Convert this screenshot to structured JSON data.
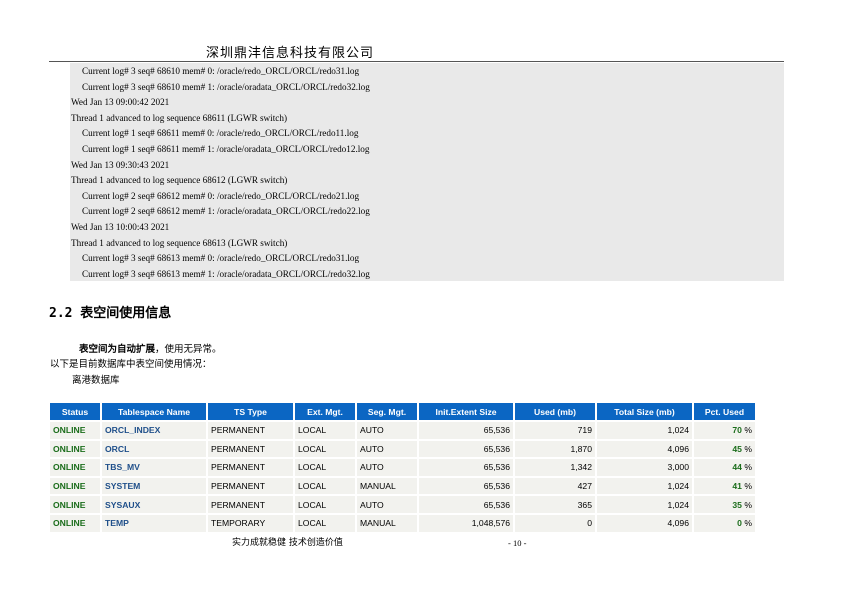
{
  "header": {
    "company": "深圳鼎沣信息科技有限公司"
  },
  "log_lines": [
    {
      "text": "Current log# 3 seq# 68610 mem# 0: /oracle/redo_ORCL/ORCL/redo31.log",
      "indent": true
    },
    {
      "text": "Current log# 3 seq# 68610 mem# 1: /oracle/oradata_ORCL/ORCL/redo32.log",
      "indent": true
    },
    {
      "text": "Wed Jan 13 09:00:42 2021",
      "indent": false
    },
    {
      "text": "Thread 1 advanced to log sequence 68611 (LGWR switch)",
      "indent": false
    },
    {
      "text": "Current log# 1 seq# 68611 mem# 0: /oracle/redo_ORCL/ORCL/redo11.log",
      "indent": true
    },
    {
      "text": "Current log# 1 seq# 68611 mem# 1: /oracle/oradata_ORCL/ORCL/redo12.log",
      "indent": true
    },
    {
      "text": "Wed Jan 13 09:30:43 2021",
      "indent": false
    },
    {
      "text": "Thread 1 advanced to log sequence 68612 (LGWR switch)",
      "indent": false
    },
    {
      "text": "Current log# 2 seq# 68612 mem# 0: /oracle/redo_ORCL/ORCL/redo21.log",
      "indent": true
    },
    {
      "text": "Current log# 2 seq# 68612 mem# 1: /oracle/oradata_ORCL/ORCL/redo22.log",
      "indent": true
    },
    {
      "text": "Wed Jan 13 10:00:43 2021",
      "indent": false
    },
    {
      "text": "Thread 1 advanced to log sequence 68613 (LGWR switch)",
      "indent": false
    },
    {
      "text": "Current log# 3 seq# 68613 mem# 0: /oracle/redo_ORCL/ORCL/redo31.log",
      "indent": true
    },
    {
      "text": "Current log# 3 seq# 68613 mem# 1: /oracle/oradata_ORCL/ORCL/redo32.log",
      "indent": true
    }
  ],
  "section": {
    "title": "2.2 表空间使用信息",
    "note_bold": "表空间为自动扩展",
    "note_rest": "，使用无异常。",
    "intro": "以下是目前数据库中表空间使用情况：",
    "db_name": "离港数据库"
  },
  "table": {
    "headers": [
      "Status",
      "Tablespace Name",
      "TS Type",
      "Ext. Mgt.",
      "Seg. Mgt.",
      "Init.Extent Size",
      "Used (mb)",
      "Total Size (mb)",
      "Pct. Used"
    ],
    "rows": [
      {
        "status": "ONLINE",
        "name": "ORCL_INDEX",
        "type": "PERMANENT",
        "ext": "LOCAL",
        "seg": "AUTO",
        "init": "65,536",
        "used": "719",
        "total": "1,024",
        "pct": "70",
        "pct_unit": "%"
      },
      {
        "status": "ONLINE",
        "name": "ORCL",
        "type": "PERMANENT",
        "ext": "LOCAL",
        "seg": "AUTO",
        "init": "65,536",
        "used": "1,870",
        "total": "4,096",
        "pct": "45",
        "pct_unit": "%"
      },
      {
        "status": "ONLINE",
        "name": "TBS_MV",
        "type": "PERMANENT",
        "ext": "LOCAL",
        "seg": "AUTO",
        "init": "65,536",
        "used": "1,342",
        "total": "3,000",
        "pct": "44",
        "pct_unit": "%"
      },
      {
        "status": "ONLINE",
        "name": "SYSTEM",
        "type": "PERMANENT",
        "ext": "LOCAL",
        "seg": "MANUAL",
        "init": "65,536",
        "used": "427",
        "total": "1,024",
        "pct": "41",
        "pct_unit": "%"
      },
      {
        "status": "ONLINE",
        "name": "SYSAUX",
        "type": "PERMANENT",
        "ext": "LOCAL",
        "seg": "AUTO",
        "init": "65,536",
        "used": "365",
        "total": "1,024",
        "pct": "35",
        "pct_unit": "%"
      },
      {
        "status": "ONLINE",
        "name": "TEMP",
        "type": "TEMPORARY",
        "ext": "LOCAL",
        "seg": "MANUAL",
        "init": "1,048,576",
        "used": "0",
        "total": "4,096",
        "pct": "0",
        "pct_unit": "%"
      }
    ]
  },
  "footer": {
    "slogan": "实力成就稳健  技术创造价值",
    "page": "- 10 -"
  },
  "colors": {
    "header_bg": "#0b66c3",
    "status_green": "#1b6d1b",
    "name_blue": "#1f4f8a",
    "log_bg": "#e9e9e9"
  }
}
